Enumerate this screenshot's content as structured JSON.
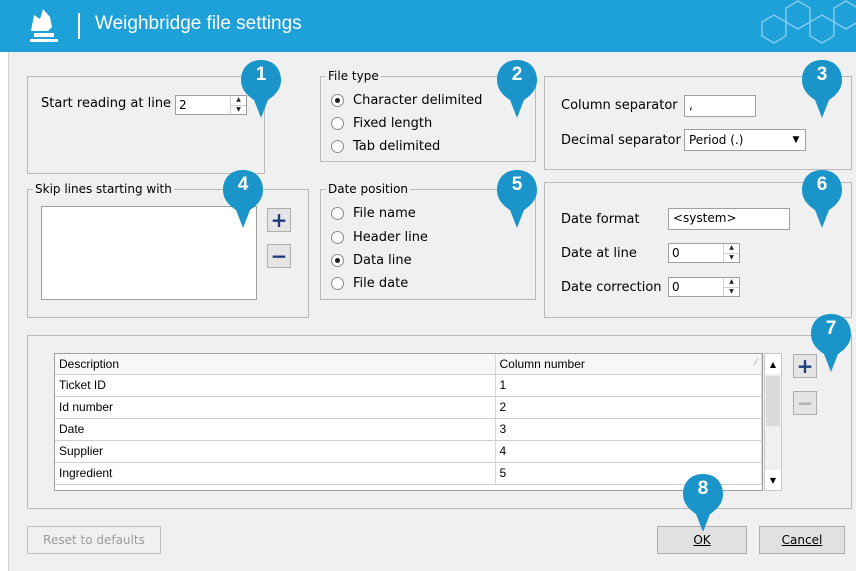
{
  "window": {
    "title": "Weighbridge file settings"
  },
  "start_reading": {
    "label": "Start reading at line",
    "value": "2"
  },
  "file_type": {
    "legend": "File type",
    "options": [
      "Character delimited",
      "Fixed length",
      "Tab delimited"
    ],
    "selected": "Character delimited"
  },
  "separators": {
    "column_label": "Column separator",
    "column_value": ",",
    "decimal_label": "Decimal separator",
    "decimal_value": "Period (.)"
  },
  "skip_lines": {
    "legend": "Skip lines starting with",
    "add": "+",
    "remove": "−"
  },
  "date_position": {
    "legend": "Date position",
    "options": [
      "File name",
      "Header line",
      "Data line",
      "File date"
    ],
    "selected": "Data line"
  },
  "date_settings": {
    "format_label": "Date format",
    "format_value": "<system>",
    "line_label": "Date at line",
    "line_value": "0",
    "correction_label": "Date correction",
    "correction_value": "0"
  },
  "columns_table": {
    "headers": [
      "Description",
      "Column number"
    ],
    "rows": [
      [
        "Ticket ID",
        "1"
      ],
      [
        "Id number",
        "2"
      ],
      [
        "Date",
        "3"
      ],
      [
        "Supplier",
        "4"
      ],
      [
        "Ingredient",
        "5"
      ]
    ],
    "add": "+",
    "remove": "−"
  },
  "buttons": {
    "reset": "Reset to defaults",
    "ok": "OK",
    "cancel": "Cancel"
  },
  "callouts": [
    "1",
    "2",
    "3",
    "4",
    "5",
    "6",
    "7",
    "8"
  ],
  "colors": {
    "title_bar": "#1ea0d8",
    "callout": "#1b95c9",
    "background": "#f0f0f0"
  }
}
